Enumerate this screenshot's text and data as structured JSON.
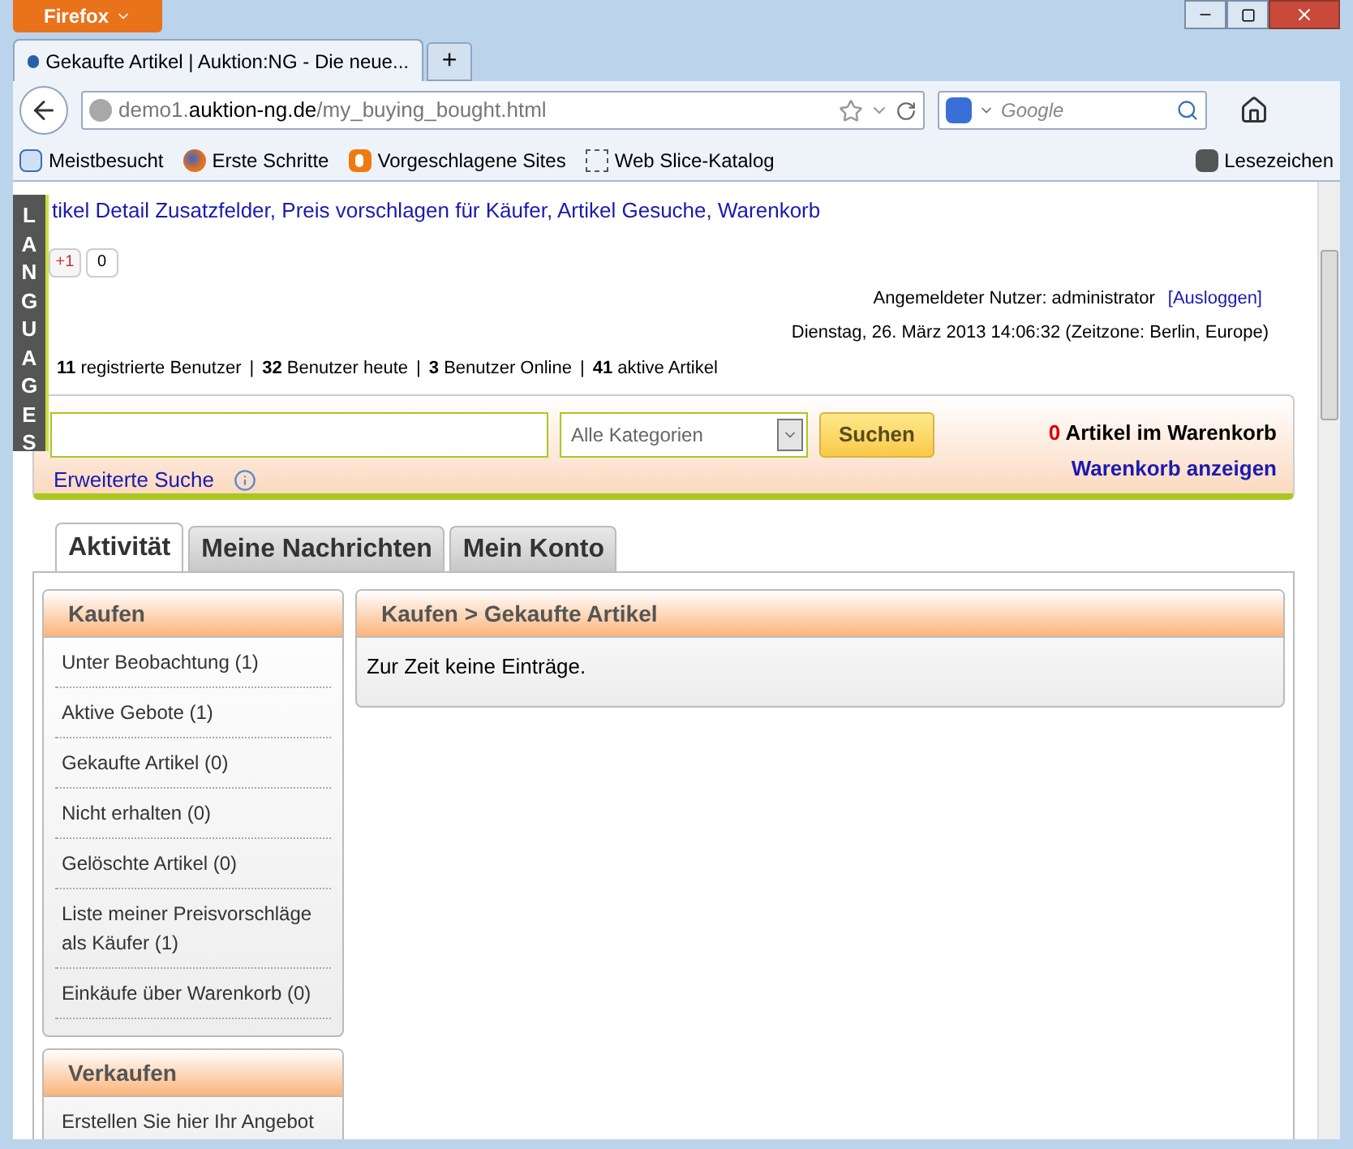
{
  "browser": {
    "app_button": "Firefox",
    "tabs": [
      {
        "title": "Gekaufte Artikel | Auktion:NG - Die neue...",
        "selected": true
      }
    ],
    "new_tab": "+",
    "url": {
      "prefix": "demo1.",
      "domain": "auktion-ng.de",
      "path": "/my_buying_bought.html"
    },
    "search_placeholder": "Google",
    "bookmarks": [
      {
        "kind": "page",
        "label": "Meistbesucht"
      },
      {
        "kind": "globe",
        "label": "Erste Schritte"
      },
      {
        "kind": "bulb",
        "label": "Vorgeschlagene Sites"
      },
      {
        "kind": "slice",
        "label": "Web Slice-Katalog"
      }
    ],
    "bookmarks_menu": "Lesezeichen"
  },
  "page": {
    "languages_tab": "LANGUAGES",
    "link_separator": ",",
    "stats_separator": "|",
    "module_links": [
      "tikel Detail Zusatzfelder",
      "Preis vorschlagen für Käufer",
      "Artikel Gesuche",
      "Warenkorb"
    ],
    "plusone": {
      "label": "+1",
      "count": "0"
    },
    "user_line": {
      "label": "Angemeldeter Nutzer: administrator",
      "logout": "[Ausloggen]"
    },
    "date_line": "Dienstag, 26. März 2013 14:06:32 (Zeitzone: Berlin, Europe)",
    "stats": [
      {
        "count": "11",
        "label": "registrierte Benutzer"
      },
      {
        "count": "32",
        "label": "Benutzer heute"
      },
      {
        "count": "3",
        "label": "Benutzer Online"
      },
      {
        "count": "41",
        "label": "aktive Artikel"
      }
    ],
    "search": {
      "category": "Alle Kategorien",
      "button": "Suchen",
      "advanced": "Erweiterte Suche",
      "cart_count": "0",
      "cart_label": "Artikel im Warenkorb",
      "cart_link": "Warenkorb anzeigen"
    },
    "tabs": [
      {
        "label": "Aktivität",
        "selected": true
      },
      {
        "label": "Meine Nachrichten",
        "selected": false
      },
      {
        "label": "Mein Konto",
        "selected": false
      }
    ],
    "sidebar": [
      {
        "title": "Kaufen",
        "items": [
          "Unter Beobachtung (1)",
          "Aktive Gebote (1)",
          "Gekaufte Artikel (0)",
          "Nicht erhalten (0)",
          "Gelöschte Artikel (0)",
          "Liste meiner Preisvorschläge als Käufer (1)",
          "Einkäufe über Warenkorb (0)"
        ]
      },
      {
        "title": "Verkaufen",
        "items": [
          "Erstellen Sie hier Ihr Angebot"
        ]
      }
    ],
    "main": {
      "title": "Kaufen > Gekaufte Artikel",
      "message": "Zur Zeit keine Einträge."
    }
  }
}
